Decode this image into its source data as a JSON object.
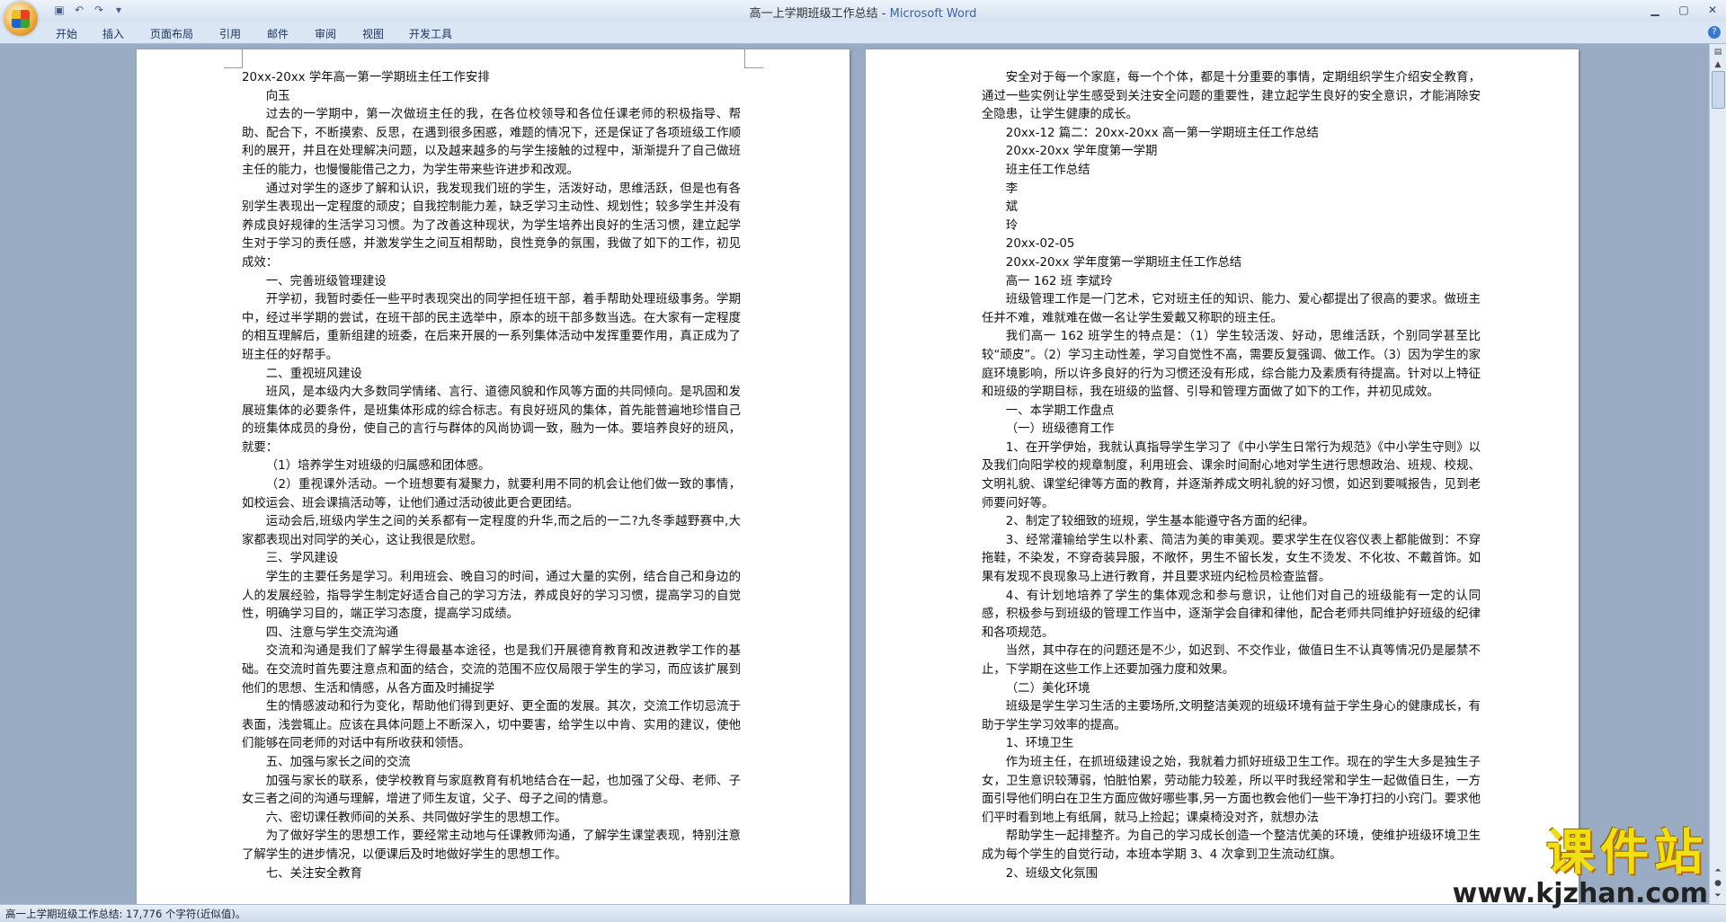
{
  "window": {
    "doc_name": "高一上学期班级工作总结",
    "separator": " - ",
    "app_name": "Microsoft Word"
  },
  "ribbon_tabs": [
    "开始",
    "插入",
    "页面布局",
    "引用",
    "邮件",
    "审阅",
    "视图",
    "开发工具"
  ],
  "page1": [
    {
      "t": "20xx-20xx 学年高一第一学期班主任工作安排",
      "c": ""
    },
    {
      "t": "向玉",
      "c": "h"
    },
    {
      "t": "过去的一学期中，第一次做班主任的我，在各位校领导和各位任课老师的积极指导、帮助、配合下，不断摸索、反思，在遇到很多困惑，难题的情况下，还是保证了各项班级工作顺利的展开，并且在处理解决问题，以及越来越多的与学生接触的过程中，渐渐提升了自己做班主任的能力，也慢慢能借己之力，为学生带来些许进步和改观。",
      "c": "ind"
    },
    {
      "t": "通过对学生的逐步了解和认识，我发现我们班的学生，活泼好动，思维活跃，但是也有各别学生表现出一定程度的顽皮；自我控制能力差，缺乏学习主动性、规划性；较多学生并没有养成良好规律的生活学习习惯。为了改善这种现状，为学生培养出良好的生活习惯，建立起学生对于学习的责任感，并激发学生之间互相帮助，良性竞争的氛围，我做了如下的工作，初见成效：",
      "c": "ind"
    },
    {
      "t": "一、完善班级管理建设",
      "c": "h"
    },
    {
      "t": "开学初，我暂时委任一些平时表现突出的同学担任班干部，着手帮助处理班级事务。学期中，经过半学期的尝试，在班干部的民主选举中，原本的班干部多数当选。在大家有一定程度的相互理解后，重新组建的班委，在后来开展的一系列集体活动中发挥重要作用，真正成为了班主任的好帮手。",
      "c": "ind"
    },
    {
      "t": "二、重视班风建设",
      "c": "h"
    },
    {
      "t": "班风，是本级内大多数同学情绪、言行、道德风貌和作风等方面的共同倾向。是巩固和发展班集体的必要条件，是班集体形成的综合标志。有良好班风的集体，首先能普遍地珍惜自己的班集体成员的身份，使自己的言行与群体的风尚协调一致，融为一体。要培养良好的班风，就要：",
      "c": "ind"
    },
    {
      "t": "（1）培养学生对班级的归属感和团体感。",
      "c": "ind"
    },
    {
      "t": "（2）重视课外活动。一个班想要有凝聚力，就要利用不同的机会让他们做一致的事情，如校运会、班会课搞活动等，让他们通过活动彼此更合更团结。",
      "c": "ind"
    },
    {
      "t": "运动会后,班级内学生之间的关系都有一定程度的升华,而之后的一二?九冬季越野赛中,大家都表现出对同学的关心，这让我很是欣慰。",
      "c": "ind"
    },
    {
      "t": "三、学风建设",
      "c": "h"
    },
    {
      "t": "学生的主要任务是学习。利用班会、晚自习的时间，通过大量的实例，结合自己和身边的人的发展经验，指导学生制定好适合自己的学习方法，养成良好的学习习惯，提高学习的自觉性，明确学习目的，端正学习态度，提高学习成绩。",
      "c": "ind"
    },
    {
      "t": "四、注意与学生交流沟通",
      "c": "h"
    },
    {
      "t": "交流和沟通是我们了解学生得最基本途径，也是我们开展德育教育和改进教学工作的基础。在交流时首先要注意点和面的结合，交流的范围不应仅局限于学生的学习，而应该扩展到他们的思想、生活和情感，从各方面及时捕捉学",
      "c": "ind"
    },
    {
      "t": "生的情感波动和行为变化，帮助他们得到更好、更全面的发展。其次，交流工作切忌流于表面，浅尝辄止。应该在具体问题上不断深入，切中要害，给学生以中肯、实用的建议，使他们能够在同老师的对话中有所收获和领悟。",
      "c": "ind"
    },
    {
      "t": "五、加强与家长之间的交流",
      "c": "h"
    },
    {
      "t": "加强与家长的联系，使学校教育与家庭教育有机地结合在一起，也加强了父母、老师、子女三者之间的沟通与理解，增进了师生友谊，父子、母子之间的情意。",
      "c": "ind"
    },
    {
      "t": "六、密切课任教师间的关系、共同做好学生的思想工作。",
      "c": "h"
    },
    {
      "t": "为了做好学生的思想工作，要经常主动地与任课教师沟通，了解学生课堂表现，特别注意了解学生的进步情况，以便课后及时地做好学生的思想工作。",
      "c": "ind"
    },
    {
      "t": "七、关注安全教育",
      "c": "h"
    }
  ],
  "page2": [
    {
      "t": "安全对于每一个家庭，每一个个体，都是十分重要的事情，定期组织学生介绍安全教育，通过一些实例让学生感受到关注安全问题的重要性，建立起学生良好的安全意识，才能消除安全隐患，让学生健康的成长。",
      "c": "ind"
    },
    {
      "t": "20xx-12 篇二：20xx-20xx 高一第一学期班主任工作总结",
      "c": "h"
    },
    {
      "t": "20xx-20xx 学年度第一学期",
      "c": "h"
    },
    {
      "t": "班主任工作总结",
      "c": "h"
    },
    {
      "t": "李",
      "c": "h"
    },
    {
      "t": "斌",
      "c": "h"
    },
    {
      "t": "玲",
      "c": "h"
    },
    {
      "t": "20xx-02-05",
      "c": "h"
    },
    {
      "t": "20xx-20xx 学年度第一学期班主任工作总结",
      "c": "h"
    },
    {
      "t": "高一 162 班 李斌玲",
      "c": "h"
    },
    {
      "t": "班级管理工作是一门艺术，它对班主任的知识、能力、爱心都提出了很高的要求。做班主任并不难，难就难在做一名让学生爱戴又称职的班主任。",
      "c": "ind"
    },
    {
      "t": "我们高一 162 班学生的特点是：（1）学生较活泼、好动，思维活跃，个别同学甚至比较“顽皮”。（2）学习主动性差，学习自觉性不高，需要反复强调、做工作。（3）因为学生的家庭环境影响，所以许多良好的行为习惯还没有形成，综合能力及素质有待提高。针对以上特征和班级的学期目标，我在班级的监督、引导和管理方面做了如下的工作，并初见成效。",
      "c": "ind"
    },
    {
      "t": "一、本学期工作盘点",
      "c": "h"
    },
    {
      "t": "（一）班级德育工作",
      "c": "h"
    },
    {
      "t": "1、在开学伊始，我就认真指导学生学习了《中小学生日常行为规范》《中小学生守则》以及我们向阳学校的规章制度，利用班会、课余时间耐心地对学生进行思想政治、班规、校规、文明礼貌、课堂纪律等方面的教育，并逐渐养成文明礼貌的好习惯，如迟到要喊报告，见到老师要问好等。",
      "c": "ind"
    },
    {
      "t": "2、制定了较细致的班规，学生基本能遵守各方面的纪律。",
      "c": "ind"
    },
    {
      "t": "3、经常灌输给学生以朴素、简洁为美的审美观。要求学生在仪容仪表上都能做到：不穿拖鞋，不染发，不穿奇装异服，不敞怀，男生不留长发，女生不烫发、不化妆、不戴首饰。如果有发现不良现象马上进行教育，并且要求班内纪检员检查监督。",
      "c": "ind"
    },
    {
      "t": "4、有计划地培养了学生的集体观念和参与意识，让他们对自己的班级能有一定的认同感，积极参与到班级的管理工作当中，逐渐学会自律和律他，配合老师共同维护好班级的纪律和各项规范。",
      "c": "ind"
    },
    {
      "t": "当然，其中存在的问题还是不少，如迟到、不交作业，做值日生不认真等情况仍是屡禁不止，下学期在这些工作上还要加强力度和效果。",
      "c": "ind"
    },
    {
      "t": "（二）美化环境",
      "c": "h"
    },
    {
      "t": "班级是学生学习生活的主要场所,文明整洁美观的班级环境有益于学生身心的健康成长，有助于学生学习效率的提高。",
      "c": "ind"
    },
    {
      "t": "1、环境卫生",
      "c": "h"
    },
    {
      "t": "作为班主任，在抓班级建设之始，我就着力抓好班级卫生工作。现在的学生大多是独生子女，卫生意识较薄弱，怕脏怕累，劳动能力较差，所以平时我经常和学生一起做值日生，一方面引导他们明白在卫生方面应做好哪些事,另一方面也教会他们一些干净打扫的小窍门。要求他们平时看到地上有纸屑，就马上捡起；课桌椅没对齐，就想办法",
      "c": "ind"
    },
    {
      "t": "帮助学生一起排整齐。为自己的学习成长创造一个整洁优美的环境，使维护班级环境卫生成为每个学生的自觉行动，本班本学期 3、4 次拿到卫生流动红旗。",
      "c": "ind"
    },
    {
      "t": "2、班级文化氛围",
      "c": "h"
    }
  ],
  "status_bar": "高一上学期班级工作总结: 17,776 个字符(近似值)。",
  "watermark": {
    "main": "课件站",
    "url": "www.kjzhan.com"
  }
}
